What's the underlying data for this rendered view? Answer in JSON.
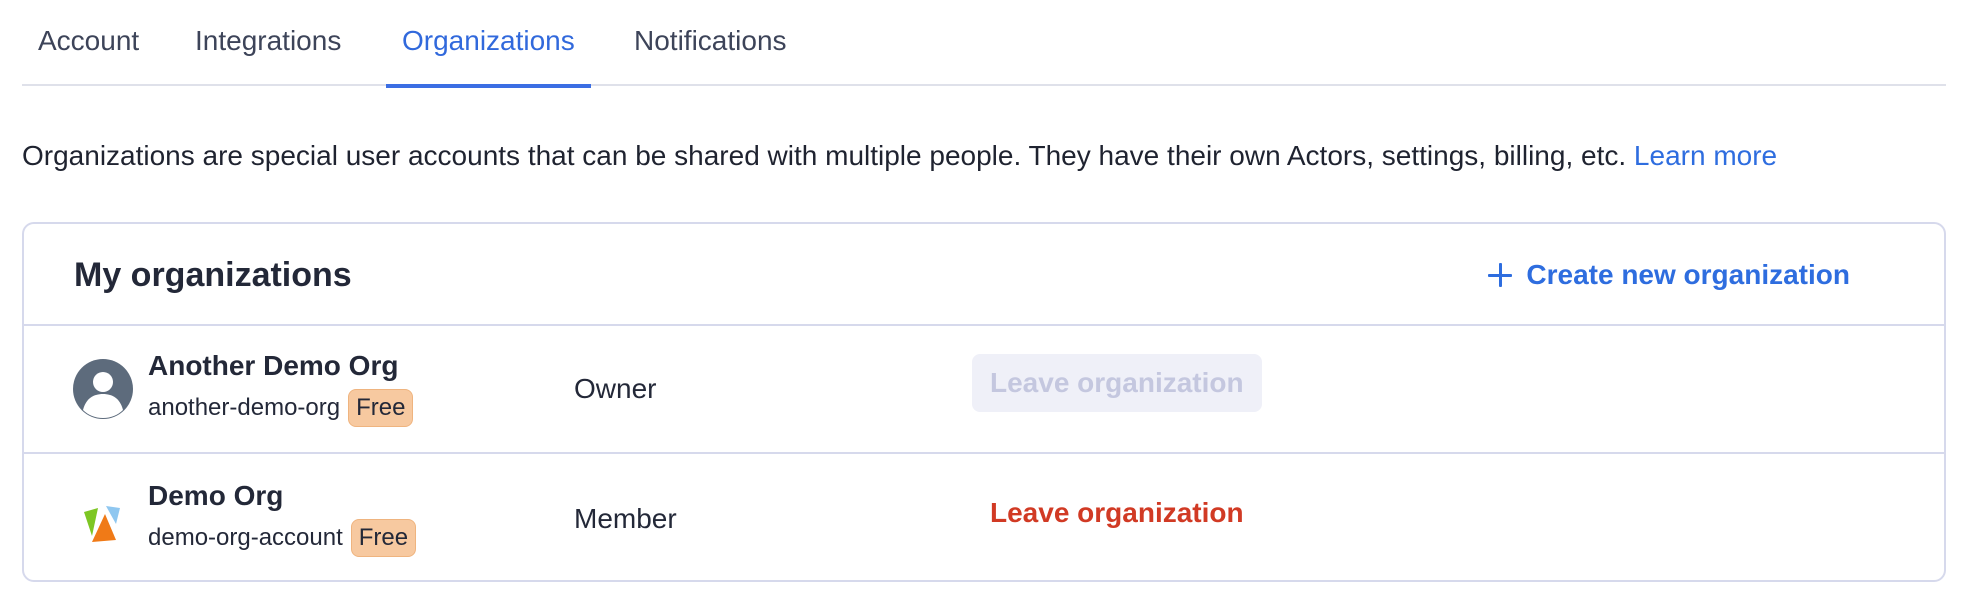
{
  "tabs": [
    {
      "label": "Account",
      "active": false
    },
    {
      "label": "Integrations",
      "active": false
    },
    {
      "label": "Organizations",
      "active": true
    },
    {
      "label": "Notifications",
      "active": false
    }
  ],
  "intro": {
    "text": "Organizations are special user accounts that can be shared with multiple people. They have their own Actors, settings, billing, etc.",
    "link": "Learn more"
  },
  "card": {
    "title": "My organizations",
    "create_label": "Create new organization",
    "create_icon": "plus-icon"
  },
  "orgs": [
    {
      "name": "Another Demo Org",
      "slug": "another-demo-org",
      "plan": "Free",
      "role": "Owner",
      "leave_label": "Leave organization",
      "leave_enabled": false,
      "avatar": "user-avatar-icon"
    },
    {
      "name": "Demo Org",
      "slug": "demo-org-account",
      "plan": "Free",
      "role": "Member",
      "leave_label": "Leave organization",
      "leave_enabled": true,
      "avatar": "org-logo-icon"
    }
  ],
  "colors": {
    "accent": "#3169dc",
    "danger": "#d13a24",
    "badge": "#f7c9a0",
    "border": "#d6d9ec"
  }
}
